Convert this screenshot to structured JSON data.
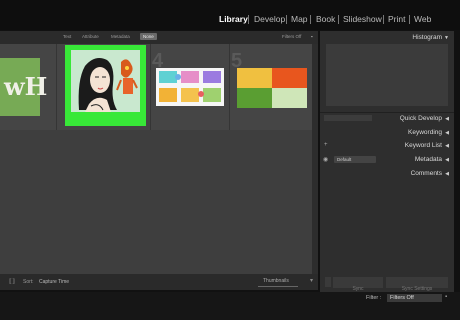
{
  "modules": [
    {
      "label": "Library"
    },
    {
      "label": "Develop"
    },
    {
      "label": "Map"
    },
    {
      "label": "Book"
    },
    {
      "label": "Slideshow"
    },
    {
      "label": "Print"
    },
    {
      "label": "Web"
    }
  ],
  "filter_bar": {
    "tabs": [
      "Text",
      "Attribute",
      "Metadata",
      "None"
    ],
    "selected": "None",
    "filters_off": "Filters Off"
  },
  "grid": {
    "cell_numbers": [
      "4",
      "5"
    ],
    "thumb1_text": "wH",
    "selected_border_color": "#33ee33"
  },
  "toolbar": {
    "sort_label": "Sort:",
    "sort_value": "Capture Time",
    "thumbnails_label": "Thumbnails"
  },
  "right_panel": {
    "histogram": "Histogram",
    "quick_develop": "Quick Develop",
    "keywording": "Keywording",
    "keyword_list": "Keyword List",
    "metadata": "Metadata",
    "metadata_preset": "Default",
    "comments": "Comments",
    "sync": "Sync",
    "sync_settings": "Sync Settings"
  },
  "bottom": {
    "filter_label": "Filter :",
    "filter_value": "Filters Off"
  }
}
